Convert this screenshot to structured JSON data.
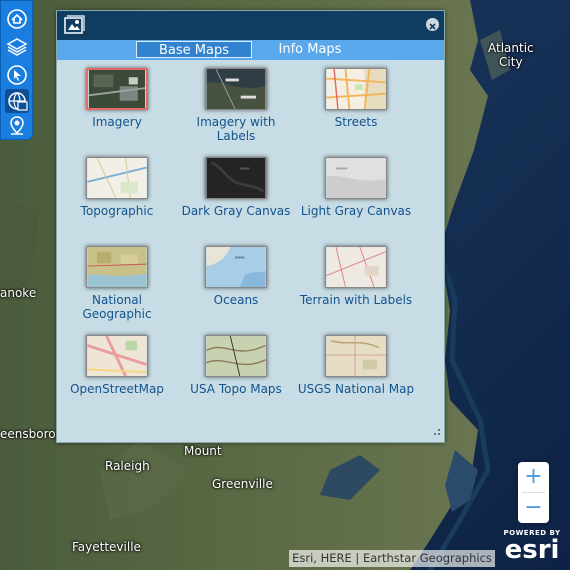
{
  "map": {
    "labels": {
      "atlantic_city": "Atlantic\nCity",
      "roanoke": "anoke",
      "greensboro": "eensboro",
      "raleigh": "Raleigh",
      "mount": "Mount",
      "greenville": "Greenville",
      "fayetteville": "Fayetteville"
    },
    "attribution": "Esri, HERE | Earthstar Geographics",
    "logo": {
      "powered_by": "POWERED BY",
      "brand": "esri"
    },
    "zoom": {
      "in": "+",
      "out": "−"
    }
  },
  "toolbar": {
    "tools": [
      "home-icon",
      "layers-icon",
      "select-icon",
      "basemap-gallery-icon",
      "location-icon"
    ],
    "active_tool": "basemap-gallery-icon"
  },
  "panel": {
    "header_icon": "basemap-gallery-icon",
    "close_icon": "close-icon",
    "tabs": {
      "base_maps": "Base Maps",
      "info_maps": "Info Maps"
    },
    "active_tab": "Base Maps",
    "basemaps": [
      {
        "label": "Imagery",
        "selected": true
      },
      {
        "label": "Imagery with Labels"
      },
      {
        "label": "Streets"
      },
      {
        "label": "Topographic"
      },
      {
        "label": "Dark Gray Canvas"
      },
      {
        "label": "Light Gray Canvas"
      },
      {
        "label": "National Geographic"
      },
      {
        "label": "Oceans"
      },
      {
        "label": "Terrain with Labels"
      },
      {
        "label": "OpenStreetMap"
      },
      {
        "label": "USA Topo Maps"
      },
      {
        "label": "USGS National Map"
      }
    ]
  },
  "colors": {
    "accent": "#1a7ee0",
    "header": "#0f3d62",
    "panel": "#c8dce5",
    "label": "#13548e"
  }
}
